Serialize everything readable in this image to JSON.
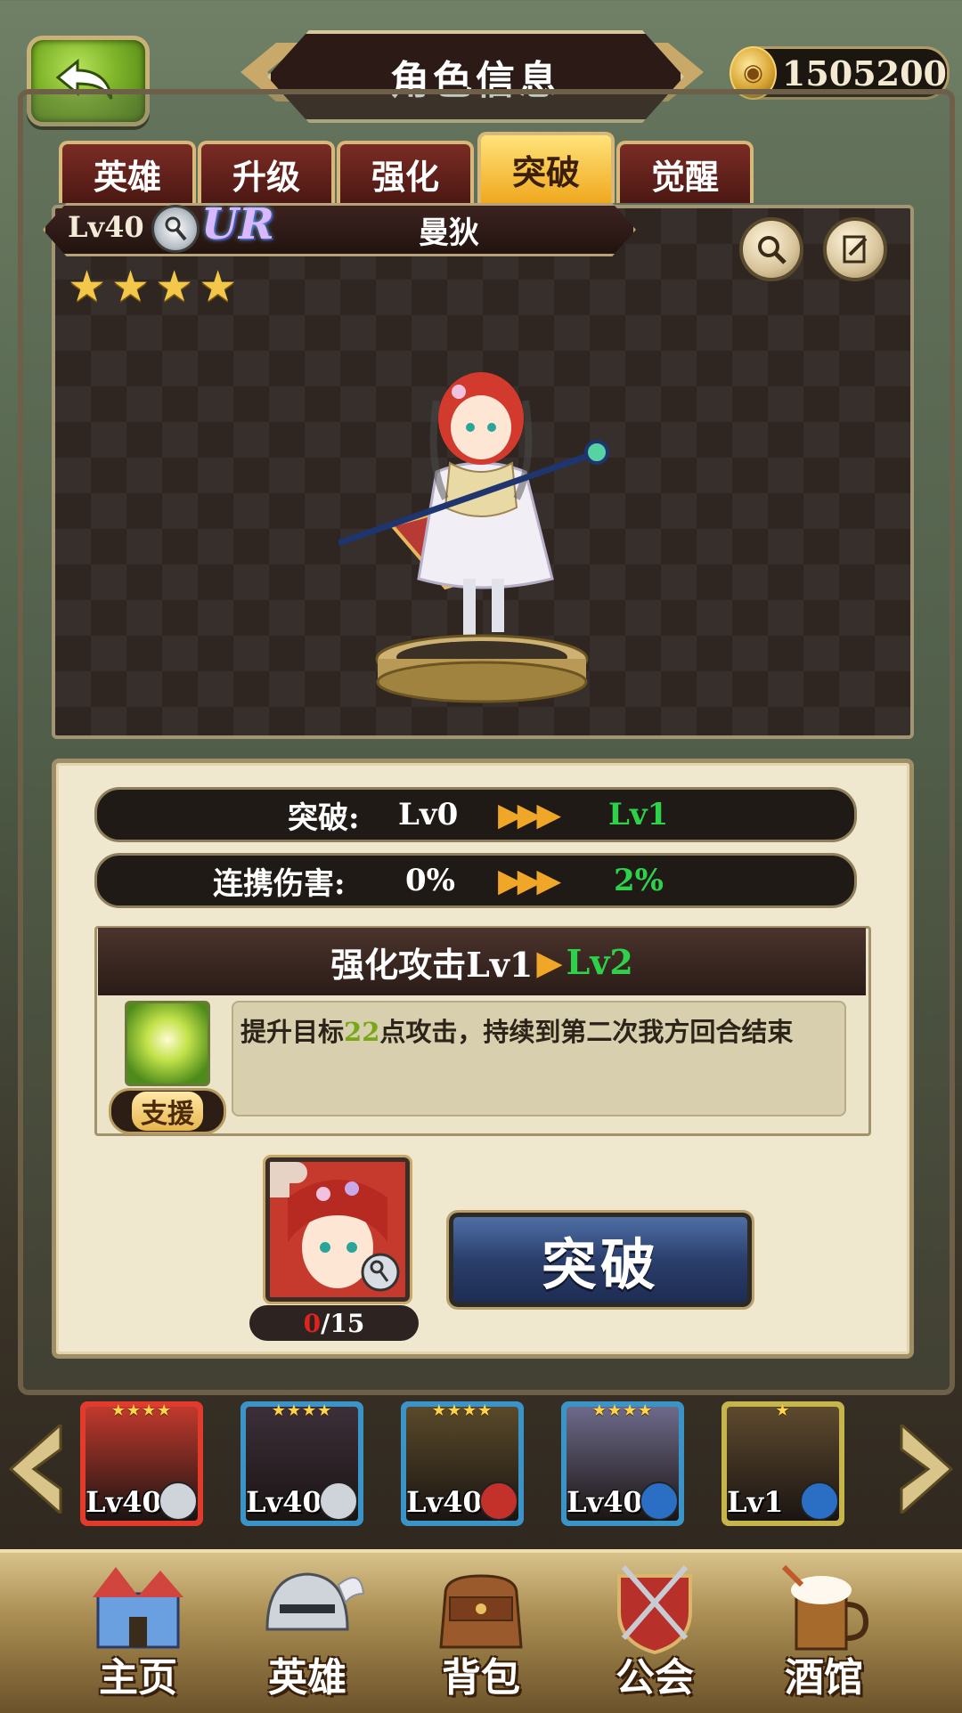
{
  "header": {
    "title": "角色信息",
    "gold": "1505200"
  },
  "tabs": [
    "英雄",
    "升级",
    "强化",
    "突破",
    "觉醒"
  ],
  "active_tab": "突破",
  "hero": {
    "level": "Lv40",
    "rarity": "UR",
    "name": "曼狄",
    "stars": 4,
    "class_icon": "staff-icon"
  },
  "breakthrough": {
    "label": "突破:",
    "from": "Lv0",
    "to": "Lv1"
  },
  "combo_damage": {
    "label": "连携伤害:",
    "from": "0%",
    "to": "2%"
  },
  "skill": {
    "name": "强化攻击Lv1",
    "new_level": "Lv2",
    "tag": "支援",
    "desc_before": "提升目标",
    "desc_num": "22",
    "desc_after": "点攻击，持续到第二次我方回合结束"
  },
  "material": {
    "current": "0",
    "total": "/15"
  },
  "break_button": "突破",
  "roster": [
    {
      "level": "Lv40",
      "stars": "★★★★",
      "class": "staff-icon",
      "frame": "#e23b2c",
      "bg": "#c1392d"
    },
    {
      "level": "Lv40",
      "stars": "★★★★",
      "class": "staff-icon",
      "frame": "#3b94c8",
      "bg": "#3c2f3a"
    },
    {
      "level": "Lv40",
      "stars": "★★★★",
      "class": "sword-icon",
      "frame": "#3b94c8",
      "bg": "#5a4a2a"
    },
    {
      "level": "Lv40",
      "stars": "★★★★",
      "class": "spear-icon",
      "frame": "#3b94c8",
      "bg": "#6d6a8a"
    },
    {
      "level": "Lv1",
      "stars": "★",
      "class": "spear-icon",
      "frame": "#c6b54a",
      "bg": "#5e4a2e"
    }
  ],
  "nav": [
    "主页",
    "英雄",
    "背包",
    "公会",
    "酒馆"
  ],
  "colors": {
    "accent_green": "#2ed24a",
    "arrow_orange": "#f0a627",
    "count_red": "#e0231b"
  }
}
